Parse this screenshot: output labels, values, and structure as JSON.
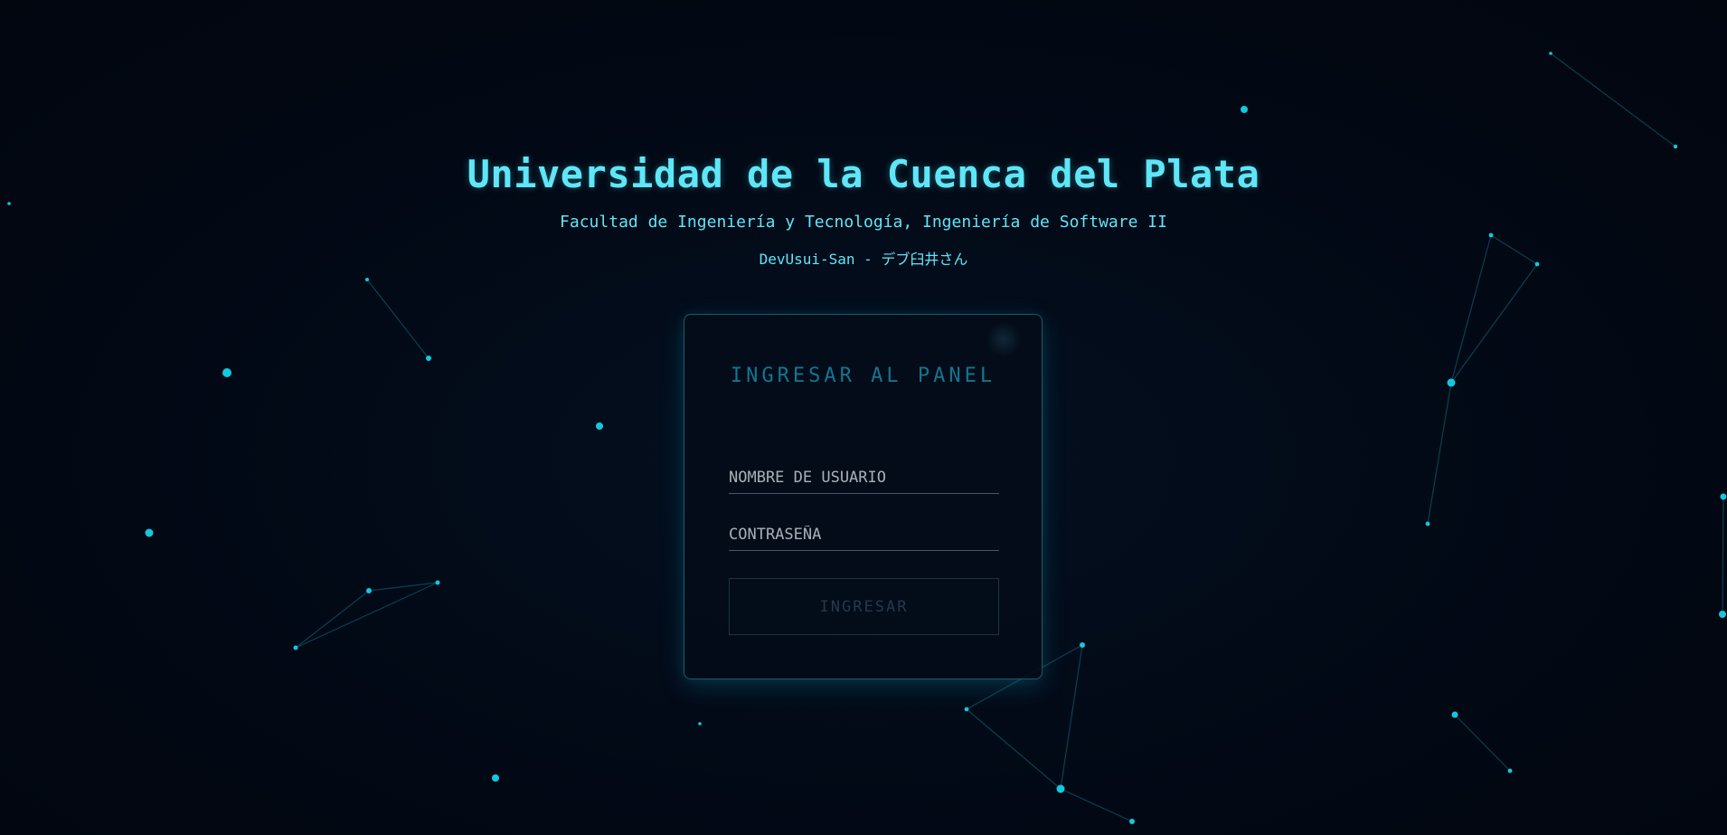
{
  "header": {
    "title": "Universidad de la Cuenca del Plata",
    "subtitle": "Facultad de Ingeniería y Tecnología, Ingeniería de Software II",
    "author": "DevUsui-San - デブ臼井さん"
  },
  "login": {
    "heading": "INGRESAR AL PANEL",
    "username_placeholder": "NOMBRE DE USUARIO",
    "password_placeholder": "CONTRASEÑA",
    "submit_label": "INGRESAR"
  },
  "colors": {
    "background": "#020814",
    "accent": "#5fe6f7",
    "panel_heading": "#127690",
    "particle": "#13c8dd",
    "link": "#0e6f7e"
  }
}
